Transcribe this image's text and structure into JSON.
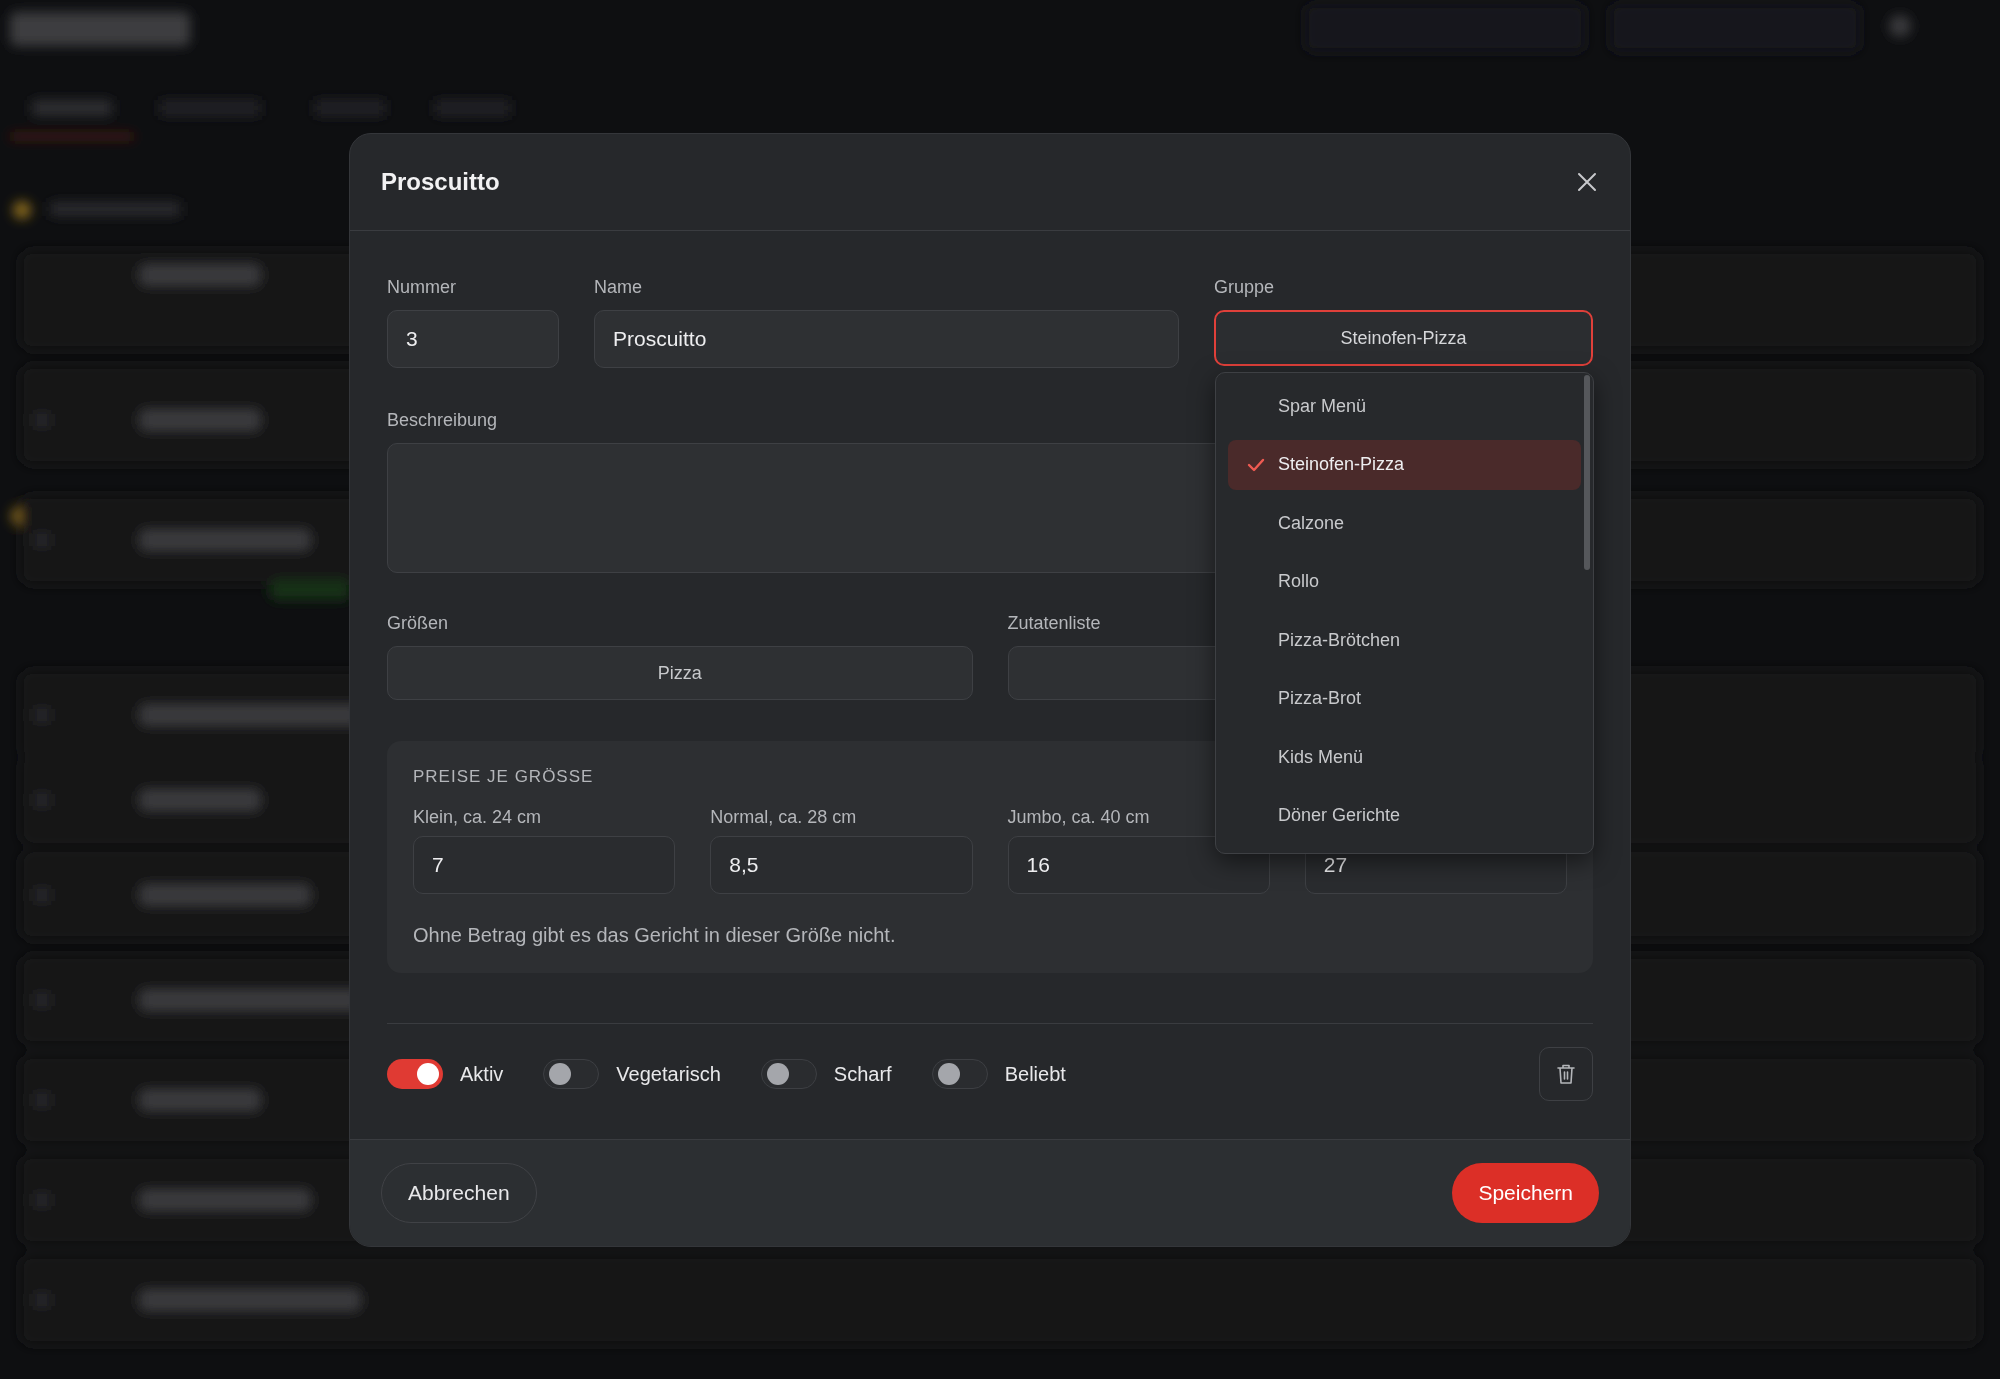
{
  "dialog": {
    "title": "Proscuitto"
  },
  "fields": {
    "number": {
      "label": "Nummer",
      "value": "3"
    },
    "name": {
      "label": "Name",
      "value": "Proscuitto"
    },
    "group": {
      "label": "Gruppe",
      "value": "Steinofen-Pizza",
      "open": true
    },
    "description": {
      "label": "Beschreibung"
    }
  },
  "sizes": {
    "label": "Größen",
    "value": "Pizza"
  },
  "ingredients": {
    "label": "Zutatenliste"
  },
  "prices": {
    "heading": "PREISE JE GRÖSSE",
    "columns": [
      {
        "label": "Klein, ca. 24 cm",
        "value": "7"
      },
      {
        "label": "Normal, ca. 28 cm",
        "value": "8,5"
      },
      {
        "label": "Jumbo, ca. 40 cm",
        "value": "16"
      },
      {
        "value": "27"
      }
    ],
    "note": "Ohne Betrag gibt es das Gericht in dieser Größe nicht."
  },
  "toggles": [
    {
      "label": "Aktiv",
      "on": true
    },
    {
      "label": "Vegetarisch",
      "on": false
    },
    {
      "label": "Scharf",
      "on": false
    },
    {
      "label": "Beliebt",
      "on": false
    }
  ],
  "group_menu": [
    {
      "label": "Spar Menü",
      "selected": false
    },
    {
      "label": "Steinofen-Pizza",
      "selected": true
    },
    {
      "label": "Calzone",
      "selected": false
    },
    {
      "label": "Rollo",
      "selected": false
    },
    {
      "label": "Pizza-Brötchen",
      "selected": false
    },
    {
      "label": "Pizza-Brot",
      "selected": false
    },
    {
      "label": "Kids Menü",
      "selected": false
    },
    {
      "label": "Döner Gerichte",
      "selected": false
    }
  ],
  "buttons": {
    "cancel": "Abbrechen",
    "save": "Speichern"
  }
}
